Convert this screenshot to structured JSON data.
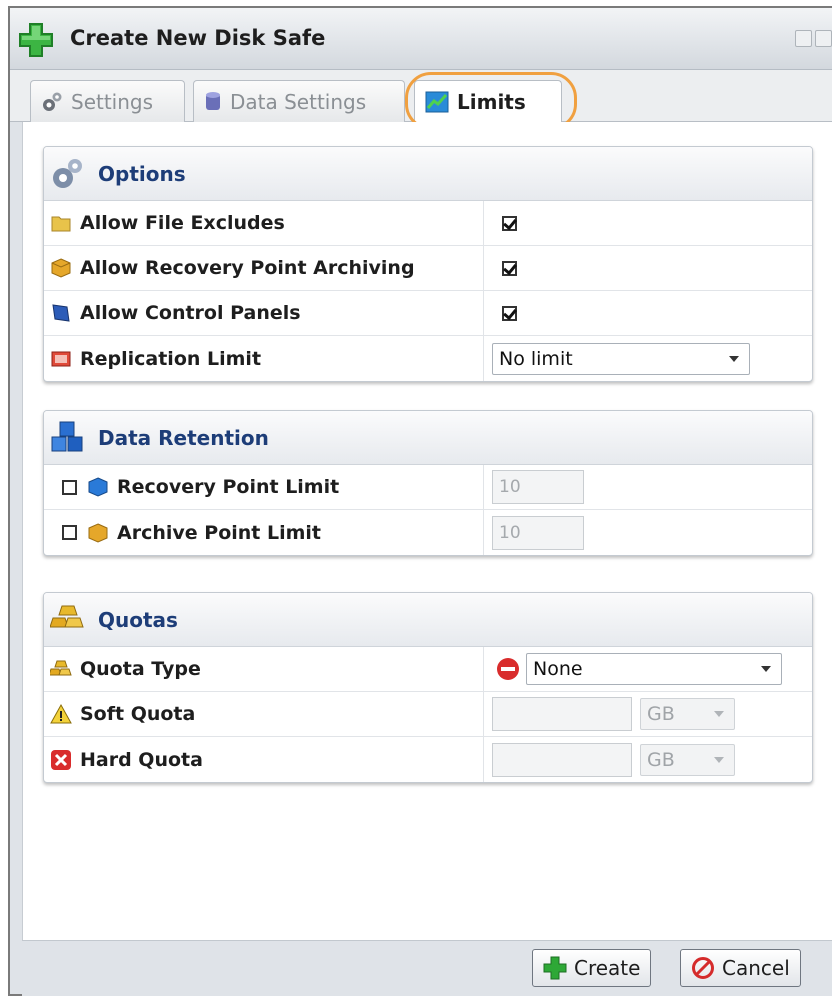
{
  "window": {
    "title": "Create New Disk Safe"
  },
  "tabs": [
    {
      "label": "Settings",
      "icon": "gears-icon"
    },
    {
      "label": "Data Settings",
      "icon": "database-icon"
    },
    {
      "label": "Limits",
      "icon": "chart-icon"
    }
  ],
  "active_tab": "Limits",
  "options": {
    "title": "Options",
    "allow_file_excludes": {
      "label": "Allow File Excludes",
      "checked": true
    },
    "allow_archiving": {
      "label": "Allow Recovery Point Archiving",
      "checked": true
    },
    "allow_control_panels": {
      "label": "Allow Control Panels",
      "checked": true
    },
    "replication_limit": {
      "label": "Replication Limit",
      "value": "No limit"
    }
  },
  "data_retention": {
    "title": "Data Retention",
    "recovery_point_limit": {
      "label": "Recovery Point Limit",
      "enabled": false,
      "value": "10"
    },
    "archive_point_limit": {
      "label": "Archive Point Limit",
      "enabled": false,
      "value": "10"
    }
  },
  "quotas": {
    "title": "Quotas",
    "quota_type": {
      "label": "Quota Type",
      "value": "None"
    },
    "soft_quota": {
      "label": "Soft Quota",
      "value": "",
      "unit": "GB"
    },
    "hard_quota": {
      "label": "Hard Quota",
      "value": "",
      "unit": "GB"
    }
  },
  "buttons": {
    "create": "Create",
    "cancel": "Cancel"
  },
  "colors": {
    "panel_title": "#1d3d78",
    "tab_highlight": "#f0a040",
    "create_green": "#2ea836",
    "cancel_red": "#d52b2b"
  }
}
